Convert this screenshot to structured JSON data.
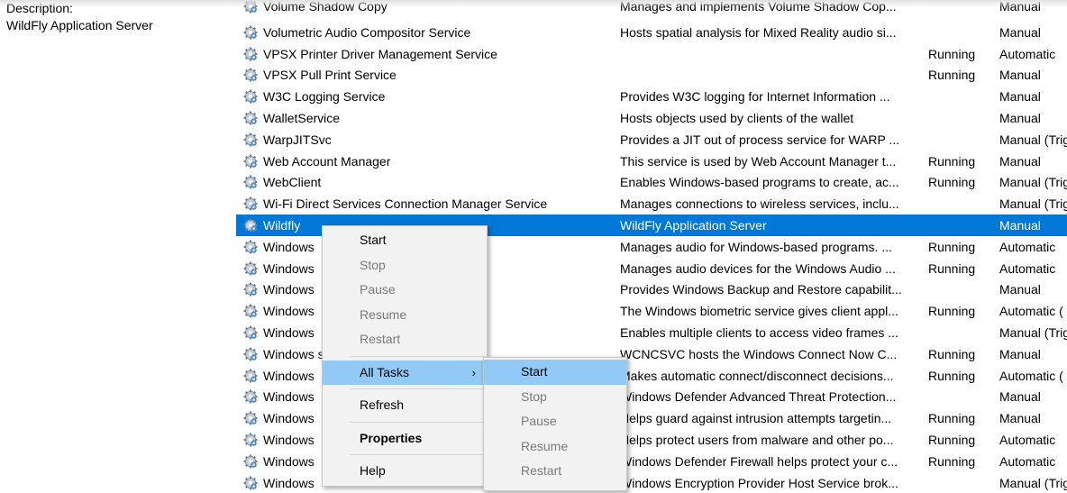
{
  "description_panel": {
    "label": "Description:",
    "text": "WildFly Application Server"
  },
  "services": [
    {
      "name": "Volume Shadow Copy",
      "description": "Manages and implements Volume Shadow Cop...",
      "status": "",
      "startup": "Manual"
    },
    {
      "name": "Volumetric Audio Compositor Service",
      "description": "Hosts spatial analysis for Mixed Reality audio si...",
      "status": "",
      "startup": "Manual"
    },
    {
      "name": "VPSX Printer Driver Management Service",
      "description": "",
      "status": "Running",
      "startup": "Automatic"
    },
    {
      "name": "VPSX Pull Print Service",
      "description": "",
      "status": "Running",
      "startup": "Manual"
    },
    {
      "name": "W3C Logging Service",
      "description": "Provides W3C logging for Internet Information ...",
      "status": "",
      "startup": "Manual"
    },
    {
      "name": "WalletService",
      "description": "Hosts objects used by clients of the wallet",
      "status": "",
      "startup": "Manual"
    },
    {
      "name": "WarpJITSvc",
      "description": "Provides a JIT out of process service for WARP ...",
      "status": "",
      "startup": "Manual (Trig"
    },
    {
      "name": "Web Account Manager",
      "description": "This service is used by Web Account Manager t...",
      "status": "Running",
      "startup": "Manual"
    },
    {
      "name": "WebClient",
      "description": "Enables Windows-based programs to create, ac...",
      "status": "Running",
      "startup": "Manual (Trig"
    },
    {
      "name": "Wi-Fi Direct Services Connection Manager Service",
      "description": "Manages connections to wireless services, inclu...",
      "status": "",
      "startup": "Manual (Trig"
    },
    {
      "name": "Wildfly",
      "description": "WildFly Application Server",
      "status": "",
      "startup": "Manual",
      "selected": true
    },
    {
      "name": "Windows",
      "description": "Manages audio for Windows-based programs. ...",
      "status": "Running",
      "startup": "Automatic"
    },
    {
      "name": "Windows",
      "description": "Manages audio devices for the Windows Audio ...",
      "status": "Running",
      "startup": "Automatic"
    },
    {
      "name": "Windows",
      "description": "Provides Windows Backup and Restore capabilit...",
      "status": "",
      "startup": "Manual"
    },
    {
      "name": "Windows",
      "description": "The Windows biometric service gives client appl...",
      "status": "Running",
      "startup": "Automatic ("
    },
    {
      "name": "Windows",
      "description": "Enables multiple clients to access video frames ...",
      "status": "",
      "startup": "Manual (Trig"
    },
    {
      "name": "Windows                                   strar",
      "description": "WCNCSVC hosts the Windows Connect Now C...",
      "status": "Running",
      "startup": "Manual"
    },
    {
      "name": "Windows",
      "description": "Makes automatic connect/disconnect decisions...",
      "status": "Running",
      "startup": "Automatic ("
    },
    {
      "name": "Windows",
      "description": "Windows Defender Advanced Threat Protection...",
      "status": "",
      "startup": "Manual"
    },
    {
      "name": "Windows",
      "description": "Helps guard against intrusion attempts targetin...",
      "status": "Running",
      "startup": "Manual"
    },
    {
      "name": "Windows",
      "description": "Helps protect users from malware and other po...",
      "status": "Running",
      "startup": "Automatic"
    },
    {
      "name": "Windows",
      "description": "Windows Defender Firewall helps protect your c...",
      "status": "Running",
      "startup": "Automatic"
    },
    {
      "name": "Windows",
      "description": "Windows Encryption Provider Host Service brok...",
      "status": "",
      "startup": "Manual (Trig"
    }
  ],
  "context_menu": {
    "start": "Start",
    "stop": "Stop",
    "pause": "Pause",
    "resume": "Resume",
    "restart": "Restart",
    "all_tasks": "All Tasks",
    "refresh": "Refresh",
    "properties": "Properties",
    "help": "Help"
  },
  "submenu": {
    "start": "Start",
    "stop": "Stop",
    "pause": "Pause",
    "resume": "Resume",
    "restart": "Restart"
  },
  "icons": {
    "service": "gear-icon",
    "submenu_arrow": "chevron-right-icon"
  },
  "colors": {
    "selection": "#0078d7",
    "menu_highlight": "#91c9f7",
    "menu_background": "#f2f2f2"
  }
}
